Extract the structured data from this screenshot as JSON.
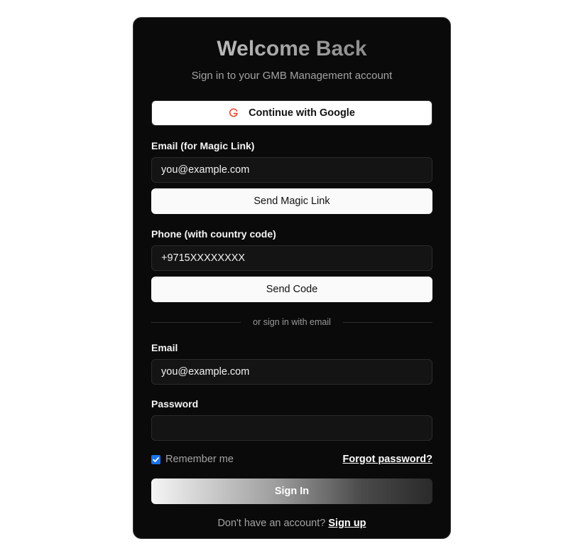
{
  "header": {
    "title": "Welcome Back",
    "subtitle": "Sign in to your GMB Management account"
  },
  "google": {
    "label": "Continue with Google",
    "icon": "google-g-icon",
    "icon_color": "#e8432c"
  },
  "magic_link": {
    "label": "Email (for Magic Link)",
    "value": "you@example.com",
    "button_label": "Send Magic Link"
  },
  "phone": {
    "label": "Phone (with country code)",
    "value": "+9715XXXXXXXX",
    "button_label": "Send Code"
  },
  "divider": {
    "text": "or sign in with email"
  },
  "email": {
    "label": "Email",
    "value": "you@example.com"
  },
  "password": {
    "label": "Password",
    "value": ""
  },
  "options": {
    "remember_label": "Remember me",
    "remember_checked": true,
    "forgot_label": "Forgot password?"
  },
  "signin": {
    "label": "Sign In"
  },
  "footer": {
    "prompt": "Don't have an account?",
    "signup_label": "Sign up"
  },
  "colors": {
    "card_background": "#0a0a0a",
    "checkbox_accent": "#1a73e8"
  }
}
